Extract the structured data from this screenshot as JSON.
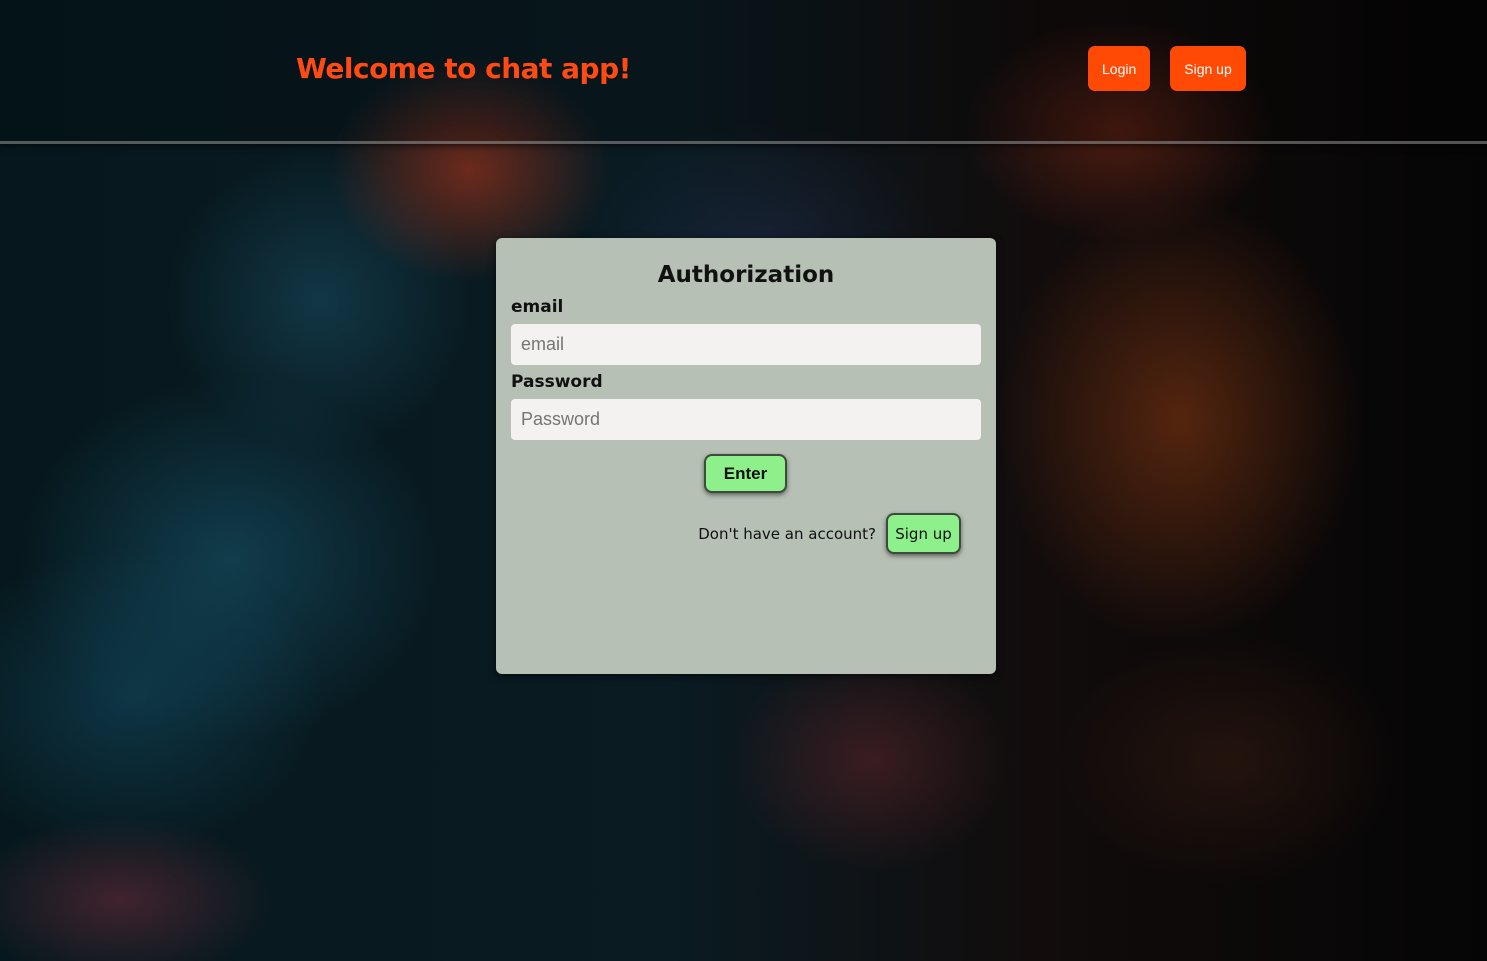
{
  "header": {
    "title": "Welcome to chat app!",
    "login_label": "Login",
    "signup_label": "Sign up"
  },
  "auth": {
    "title": "Authorization",
    "email_label": "email",
    "email_placeholder": "email",
    "email_value": "",
    "password_label": "Password",
    "password_placeholder": "Password",
    "password_value": "",
    "enter_label": "Enter",
    "no_account_text": "Don't have an account?",
    "signup_label": "Sign up"
  },
  "colors": {
    "accent_orange": "#ff4a06",
    "button_green": "#8ef08a",
    "card_background": "#b6c0b5"
  }
}
